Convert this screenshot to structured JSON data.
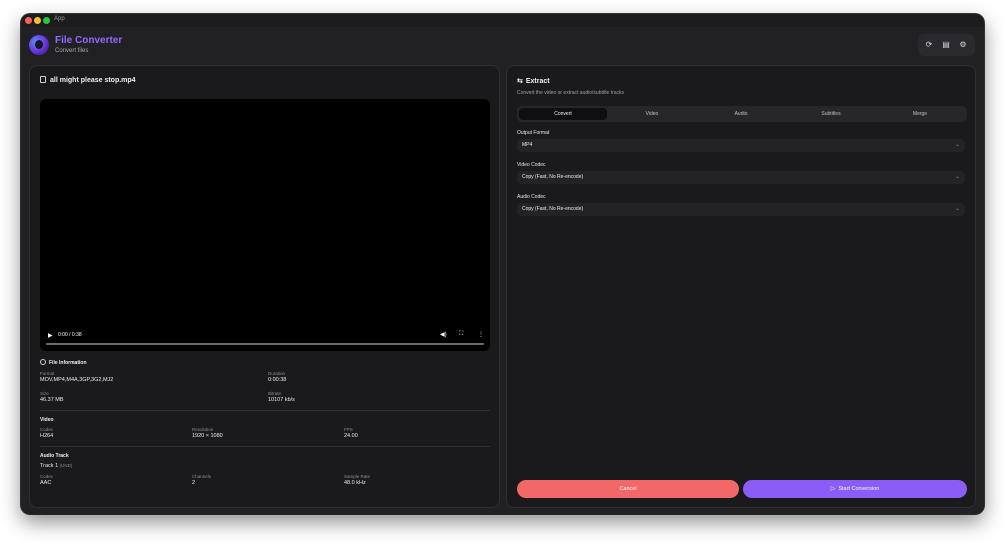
{
  "window": {
    "title": "App"
  },
  "header": {
    "title": "File Converter",
    "subtitle": "Convert files",
    "tools": [
      {
        "icon": "refresh-icon",
        "glyph": "⟳"
      },
      {
        "icon": "document-icon",
        "glyph": "▤"
      },
      {
        "icon": "gear-icon",
        "glyph": "⚙"
      }
    ]
  },
  "file": {
    "name": "all might please stop.mp4",
    "player": {
      "time": "0:00 / 0:38",
      "progress": 0
    }
  },
  "file_info": {
    "title": "File Information",
    "format_label": "Format",
    "format": "MOV,MP4,M4A,3GP,3G2,MJ2",
    "duration_label": "Duration",
    "duration": "0:00:38",
    "size_label": "Size",
    "size": "46.37 MB",
    "bitrate_label": "Bitrate",
    "bitrate": "10107 kb/s"
  },
  "video": {
    "title": "Video",
    "codec_label": "Codec",
    "codec": "H264",
    "resolution_label": "Resolution",
    "resolution": "1920 × 1080",
    "fps_label": "FPS",
    "fps": "24.00"
  },
  "audio_track": {
    "title": "Audio Track",
    "track": "Track 1",
    "lang": "(UND)",
    "codec_label": "Codec",
    "codec": "AAC",
    "channels_label": "Channels",
    "channels": "2",
    "sample_rate_label": "Sample Rate",
    "sample_rate": "48.0 kHz"
  },
  "extract": {
    "title": "Extract",
    "subtitle": "Convert the video or extract audio/subtitle tracks",
    "tabs": [
      "Convert",
      "Video",
      "Audio",
      "Subtitles",
      "Merge"
    ],
    "active_tab": "Convert",
    "output_format_label": "Output Format",
    "output_format": "MP4",
    "video_codec_label": "Video Codec",
    "video_codec": "Copy (Fast, No Re-encode)",
    "audio_codec_label": "Audio Codec",
    "audio_codec": "Copy (Fast, No Re-encode)"
  },
  "actions": {
    "cancel": "Cancel",
    "start": "Start Conversion"
  },
  "colors": {
    "accent": "#8b5cf6",
    "cancel": "#f26767",
    "title": "#8f6bff"
  }
}
